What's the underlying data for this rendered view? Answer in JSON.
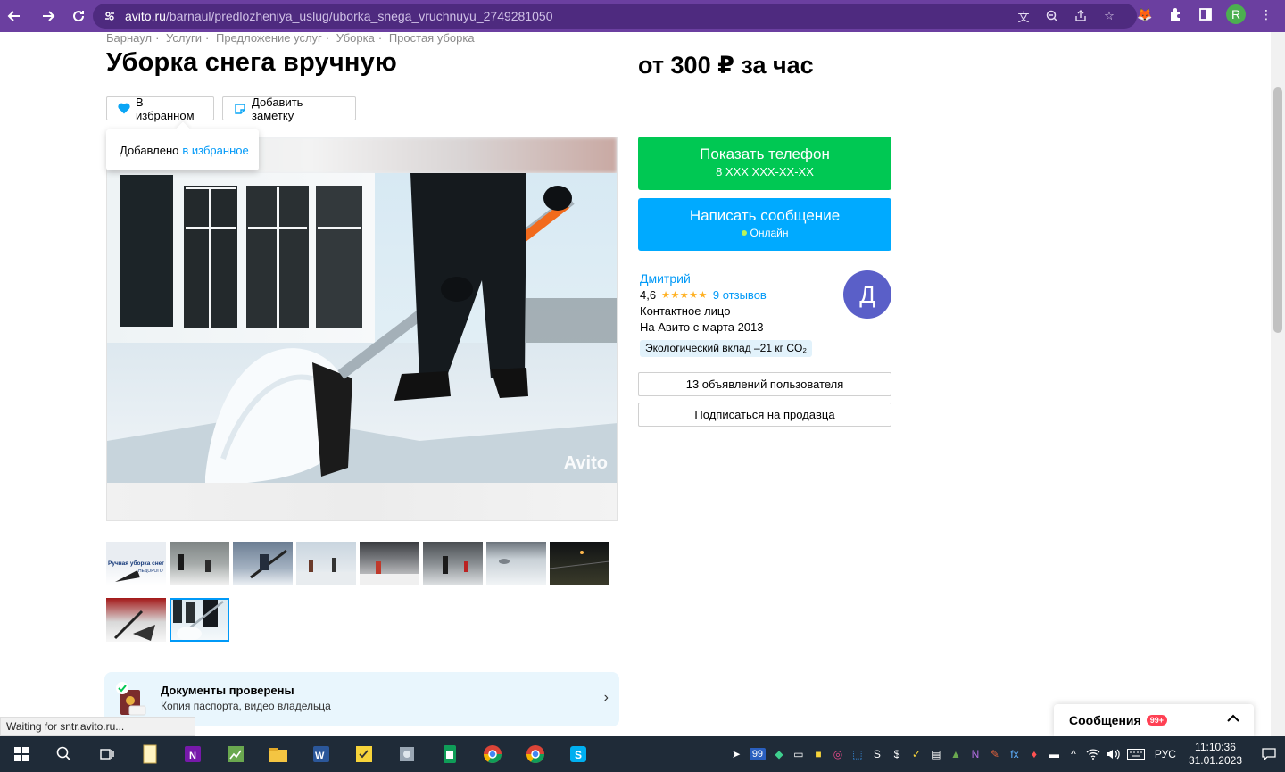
{
  "browser": {
    "url_host": "avito.ru",
    "url_path": "/barnaul/predlozheniya_uslug/uborka_snega_vruchnuyu_2749281050",
    "profile_initial": "R"
  },
  "breadcrumbs": [
    "Барнаул",
    "Услуги",
    "Предложение услуг",
    "Уборка",
    "Простая уборка"
  ],
  "listing": {
    "title": "Уборка снега вручную",
    "price": "от 300 ₽ за час",
    "favorite_label": "В избранном",
    "note_label": "Добавить заметку",
    "tooltip_text": "Добавлено",
    "tooltip_link": "в избранное",
    "watermark": "Avito"
  },
  "thumbnails": [
    {
      "label": "Ручная уборка снег",
      "label2": "НЕДОРОГО"
    },
    {},
    {},
    {},
    {},
    {},
    {},
    {},
    {},
    {}
  ],
  "docs": {
    "title": "Документы проверены",
    "subtitle": "Копия паспорта, видео владельца"
  },
  "contact": {
    "phone_button": "Показать телефон",
    "phone_masked": "8 XXX XXX-XX-XX",
    "message_button": "Написать сообщение",
    "online": "Онлайн"
  },
  "seller": {
    "name": "Дмитрий",
    "rating": "4,6",
    "reviews": "9 отзывов",
    "role": "Контактное лицо",
    "since": "На Авито с марта 2013",
    "eco": "Экологический вклад –21 кг CO₂",
    "avatar_letter": "Д",
    "ads_button": "13 объявлений пользователя",
    "subscribe_button": "Подписаться на продавца"
  },
  "messages": {
    "label": "Сообщения",
    "count": "99+"
  },
  "status": "Waiting for sntr.avito.ru...",
  "taskbar": {
    "badge": "99",
    "lang": "РУС",
    "time": "11:10:36",
    "date": "31.01.2023"
  },
  "colors": {
    "browser_bar": "#6b3fa0",
    "phone_button": "#00c853",
    "message_button": "#00aaff",
    "link": "#0099f7",
    "avatar": "#5a5fc8"
  }
}
